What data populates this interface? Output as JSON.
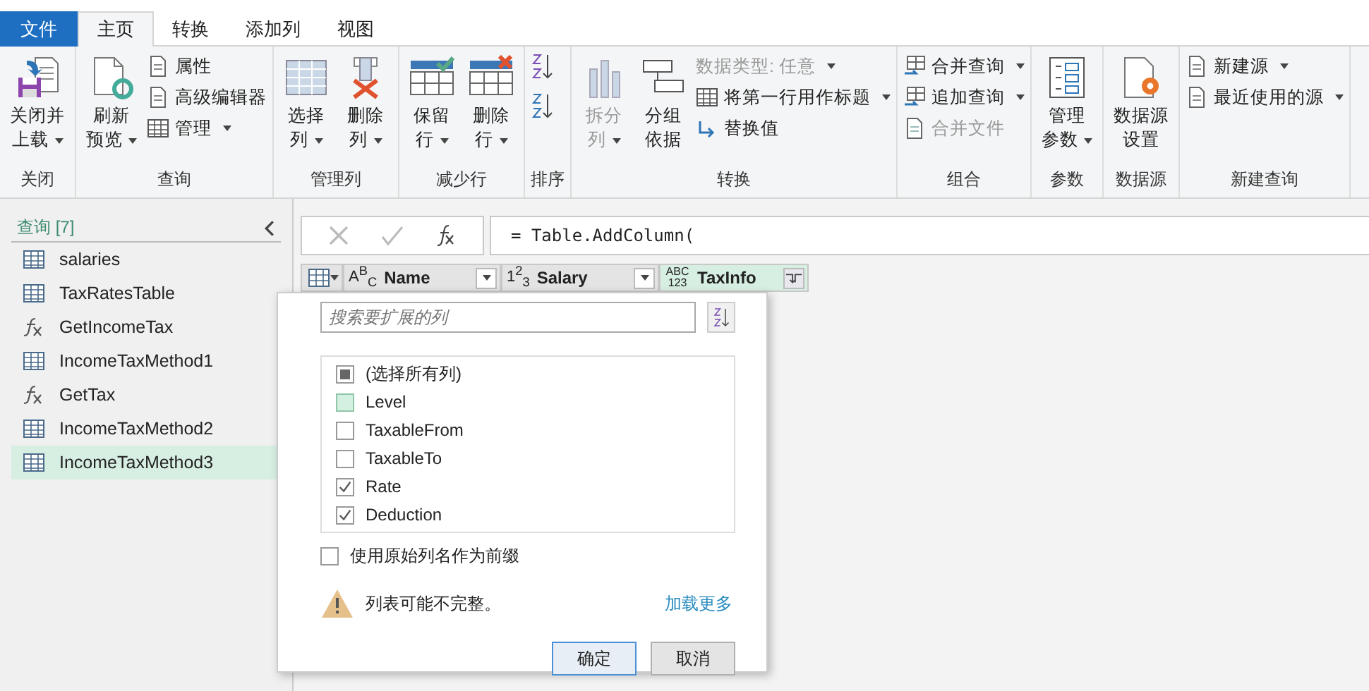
{
  "tabs": [
    {
      "label": "文件",
      "kind": "file",
      "selected": false
    },
    {
      "label": "主页",
      "kind": "tab",
      "selected": true
    },
    {
      "label": "转换",
      "kind": "tab",
      "selected": false
    },
    {
      "label": "添加列",
      "kind": "tab",
      "selected": false
    },
    {
      "label": "视图",
      "kind": "tab",
      "selected": false
    }
  ],
  "ribbon": {
    "groups": [
      {
        "label": "关闭",
        "items": [
          {
            "kind": "large",
            "lines": [
              "关闭并",
              "上载"
            ],
            "caret": true,
            "disabled": false
          }
        ]
      },
      {
        "label": "查询",
        "items": [
          {
            "kind": "large",
            "lines": [
              "刷新",
              "预览"
            ],
            "caret": true,
            "disabled": false
          },
          {
            "kind": "stack",
            "items": [
              {
                "label": "属性",
                "caret": false,
                "disabled": false
              },
              {
                "label": "高级编辑器",
                "caret": false,
                "disabled": false
              },
              {
                "label": "管理",
                "caret": true,
                "disabled": false
              }
            ]
          }
        ]
      },
      {
        "label": "管理列",
        "items": [
          {
            "kind": "large",
            "lines": [
              "选择",
              "列"
            ],
            "caret": true,
            "disabled": false
          },
          {
            "kind": "large",
            "lines": [
              "删除",
              "列"
            ],
            "caret": true,
            "disabled": false
          }
        ]
      },
      {
        "label": "减少行",
        "items": [
          {
            "kind": "large",
            "lines": [
              "保留",
              "行"
            ],
            "caret": true,
            "disabled": false
          },
          {
            "kind": "large",
            "lines": [
              "删除",
              "行"
            ],
            "caret": true,
            "disabled": false
          }
        ]
      },
      {
        "label": "排序",
        "items": [
          {
            "kind": "sort"
          }
        ]
      },
      {
        "label": "转换",
        "items": [
          {
            "kind": "large",
            "lines": [
              "拆分",
              "列"
            ],
            "caret": true,
            "disabled": true
          },
          {
            "kind": "large",
            "lines": [
              "分组",
              "依据"
            ],
            "caret": false,
            "disabled": false
          },
          {
            "kind": "stack",
            "items": [
              {
                "label": "数据类型: 任意",
                "caret": true,
                "disabled": true
              },
              {
                "label": "将第一行用作标题",
                "caret": true,
                "disabled": false
              },
              {
                "label": "替换值",
                "caret": false,
                "disabled": false
              }
            ]
          }
        ]
      },
      {
        "label": "组合",
        "items": [
          {
            "kind": "stack",
            "items": [
              {
                "label": "合并查询",
                "caret": true,
                "disabled": false
              },
              {
                "label": "追加查询",
                "caret": true,
                "disabled": false
              },
              {
                "label": "合并文件",
                "caret": false,
                "disabled": true
              }
            ]
          }
        ]
      },
      {
        "label": "参数",
        "items": [
          {
            "kind": "large",
            "lines": [
              "管理",
              "参数"
            ],
            "caret": true,
            "disabled": false
          }
        ]
      },
      {
        "label": "数据源",
        "items": [
          {
            "kind": "large",
            "lines": [
              "数据源",
              "设置"
            ],
            "caret": false,
            "disabled": false
          }
        ]
      },
      {
        "label": "新建查询",
        "items": [
          {
            "kind": "stack",
            "items": [
              {
                "label": "新建源",
                "caret": true,
                "disabled": false
              },
              {
                "label": "最近使用的源",
                "caret": true,
                "disabled": false
              }
            ]
          }
        ]
      }
    ]
  },
  "queries": {
    "title": "查询 [7]",
    "items": [
      {
        "label": "salaries",
        "kind": "table",
        "selected": false
      },
      {
        "label": "TaxRatesTable",
        "kind": "table",
        "selected": false
      },
      {
        "label": "GetIncomeTax",
        "kind": "function",
        "selected": false
      },
      {
        "label": "IncomeTaxMethod1",
        "kind": "table",
        "selected": false
      },
      {
        "label": "GetTax",
        "kind": "function",
        "selected": false
      },
      {
        "label": "IncomeTaxMethod2",
        "kind": "table",
        "selected": false
      },
      {
        "label": "IncomeTaxMethod3",
        "kind": "table",
        "selected": true
      }
    ]
  },
  "formula": {
    "text": "= Table.AddColumn("
  },
  "table": {
    "columns": [
      {
        "type": "A$^{B}$$_{C}$",
        "label": "Name",
        "kind": "filter",
        "selected": false
      },
      {
        "type": "1$^{2}$$_{3}$",
        "label": "Salary",
        "kind": "filter",
        "selected": false
      },
      {
        "type": "ABC 123",
        "label": "TaxInfo",
        "kind": "expand",
        "selected": true
      }
    ]
  },
  "expand_popup": {
    "search": {
      "placeholder": "搜索要扩展的列"
    },
    "columns": [
      {
        "label": "(选择所有列)",
        "kind": "select-all",
        "checked": false,
        "highlighted": false
      },
      {
        "label": "Level",
        "kind": "column",
        "checked": false,
        "highlighted": true
      },
      {
        "label": "TaxableFrom",
        "kind": "column",
        "checked": false,
        "highlighted": false
      },
      {
        "label": "TaxableTo",
        "kind": "column",
        "checked": false,
        "highlighted": false
      },
      {
        "label": "Rate",
        "kind": "column",
        "checked": true,
        "highlighted": false
      },
      {
        "label": "Deduction",
        "kind": "column",
        "checked": true,
        "highlighted": false
      }
    ],
    "prefix": {
      "label": "使用原始列名作为前缀",
      "checked": false
    },
    "warning": "列表可能不完整。",
    "load_more": "加载更多",
    "buttons": [
      {
        "label": "确定",
        "default": true
      },
      {
        "label": "取消",
        "default": false
      }
    ]
  }
}
